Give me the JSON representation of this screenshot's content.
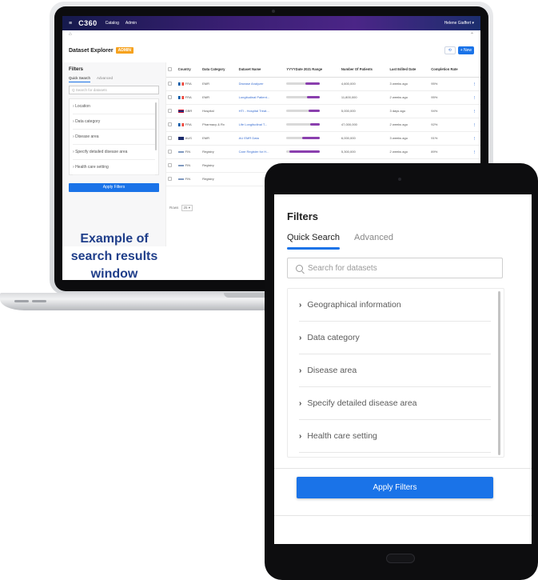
{
  "laptop": {
    "topbar": {
      "logo": "C360",
      "nav": [
        "Catalog",
        "Admin"
      ],
      "user": "Helene Giaffert ▾"
    },
    "breadcrumb": "⌂",
    "header": {
      "title": "Dataset Explorer",
      "badge": "ADMIN",
      "new_label": "+ New"
    },
    "filters": {
      "title": "Filters",
      "tabs": [
        "Quick Search",
        "Advanced"
      ],
      "search_placeholder": "Q  Search for datasets",
      "facets": [
        "Location",
        "Data category",
        "Disease area",
        "Specify detailed disease area",
        "Health care setting"
      ],
      "apply_label": "Apply Filters"
    },
    "caption": "Example of search results window",
    "table": {
      "headers": [
        "Country",
        "Data Category",
        "Dataset Name",
        "YYYYDate  2021  Range",
        "Number Of Patients",
        "Last Edited Date",
        "Completion Rate"
      ],
      "rows": [
        {
          "country": "FRA",
          "category": "EMR",
          "name": "Disease Analyzer",
          "patients": "4,600,000",
          "edited": "3 weeks ago",
          "rate": "95%"
        },
        {
          "country": "FRA",
          "category": "EMR",
          "name": "Longitudinal Patient...",
          "patients": "11,800,000",
          "edited": "2 weeks ago",
          "rate": "95%"
        },
        {
          "country": "GBR",
          "category": "Hospital",
          "name": "HTI - Hospital Treat...",
          "patients": "5,000,000",
          "edited": "3 days ago",
          "rate": "94%"
        },
        {
          "country": "FRA",
          "category": "Pharmacy & Rx",
          "name": "Life Longitudinal T...",
          "patients": "47,000,000",
          "edited": "2 weeks ago",
          "rate": "92%"
        },
        {
          "country": "AUS",
          "category": "EMR",
          "name": "AU EMR Data",
          "patients": "6,000,000",
          "edited": "3 weeks ago",
          "rate": "91%"
        },
        {
          "country": "FIN",
          "category": "Registry",
          "name": "Care Register for H...",
          "patients": "5,300,000",
          "edited": "2 weeks ago",
          "rate": "89%"
        },
        {
          "country": "FIN",
          "category": "Registry",
          "name": "",
          "patients": "",
          "edited": "",
          "rate": ""
        },
        {
          "country": "FIN",
          "category": "Registry",
          "name": "",
          "patients": "",
          "edited": "",
          "rate": ""
        }
      ],
      "rows_label": "Rows",
      "rows_value": "25 ▾"
    }
  },
  "tablet": {
    "title": "Filters",
    "tabs": [
      "Quick Search",
      "Advanced"
    ],
    "search_placeholder": "Search for datasets",
    "facets": [
      "Geographical information",
      "Data category",
      "Disease area",
      "Specify detailed disease area",
      "Health care setting"
    ],
    "apply_label": "Apply Filters"
  },
  "colors": {
    "accent": "#1a73e8",
    "badge": "#f6a21e",
    "caption": "#1f3e8a",
    "bar": "#8a3fae"
  },
  "icons": [
    "menu-icon",
    "home-icon",
    "refresh-icon",
    "search-icon",
    "chevron-right-icon",
    "more-vert-icon"
  ]
}
